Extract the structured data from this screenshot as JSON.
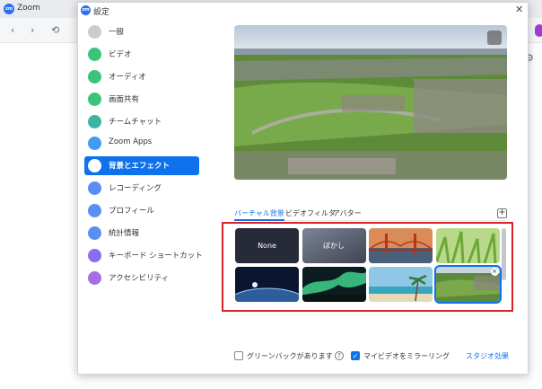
{
  "app": {
    "title": "Zoom"
  },
  "dialog": {
    "title": "設定",
    "close_glyph": "✕"
  },
  "nav": {
    "back": "‹",
    "forward": "›",
    "history": "⟲",
    "gear": "⚙"
  },
  "sidebar": {
    "items": [
      {
        "label": "一般",
        "icon": "gear-icon",
        "color": "#c9ccd1"
      },
      {
        "label": "ビデオ",
        "icon": "video-icon",
        "color": "#3cc37a"
      },
      {
        "label": "オーディオ",
        "icon": "headphones-icon",
        "color": "#3cc37a"
      },
      {
        "label": "画面共有",
        "icon": "share-screen-icon",
        "color": "#3cc37a"
      },
      {
        "label": "チームチャット",
        "icon": "chat-icon",
        "color": "#3cb5a0"
      },
      {
        "label": "Zoom Apps",
        "icon": "apps-icon",
        "color": "#3f9cf0"
      },
      {
        "label": "背景とエフェクト",
        "icon": "background-icon",
        "color": "#ffffff"
      },
      {
        "label": "レコーディング",
        "icon": "record-icon",
        "color": "#5b8ef2"
      },
      {
        "label": "プロフィール",
        "icon": "profile-icon",
        "color": "#5b8ef2"
      },
      {
        "label": "統計情報",
        "icon": "stats-icon",
        "color": "#5b8ef2"
      },
      {
        "label": "キーボード ショートカット",
        "icon": "keyboard-icon",
        "color": "#8d6cf0"
      },
      {
        "label": "アクセシビリティ",
        "icon": "accessibility-icon",
        "color": "#a56fe6"
      }
    ],
    "active_index": 6
  },
  "tabs": [
    {
      "label": "バーチャル背景",
      "active": true
    },
    {
      "label": "ビデオフィルタ",
      "active": false
    },
    {
      "label": "アバター",
      "active": false
    }
  ],
  "add_glyph": "+",
  "backgrounds": [
    {
      "label": "None",
      "icon": "none-thumb",
      "selected": false
    },
    {
      "label": "ぼかし",
      "icon": "blur-thumb",
      "selected": false
    },
    {
      "label": "",
      "icon": "golden-gate-bridge-thumb",
      "selected": false
    },
    {
      "label": "",
      "icon": "grass-thumb",
      "selected": false
    },
    {
      "label": "",
      "icon": "earth-from-space-thumb",
      "selected": false
    },
    {
      "label": "",
      "icon": "aurora-thumb",
      "selected": false
    },
    {
      "label": "",
      "icon": "beach-thumb",
      "selected": false
    },
    {
      "label": "",
      "icon": "aerial-town-thumb",
      "selected": true
    }
  ],
  "selected_remove_glyph": "×",
  "footer": {
    "greenscreen": {
      "label": "グリーンバックがあります",
      "checked": false
    },
    "help_glyph": "?",
    "mirror": {
      "label": "マイビデオをミラーリング",
      "checked": true
    },
    "studio_link": "スタジオ効果"
  },
  "colors": {
    "accent": "#0e72ed",
    "highlight": "#d9202b"
  }
}
